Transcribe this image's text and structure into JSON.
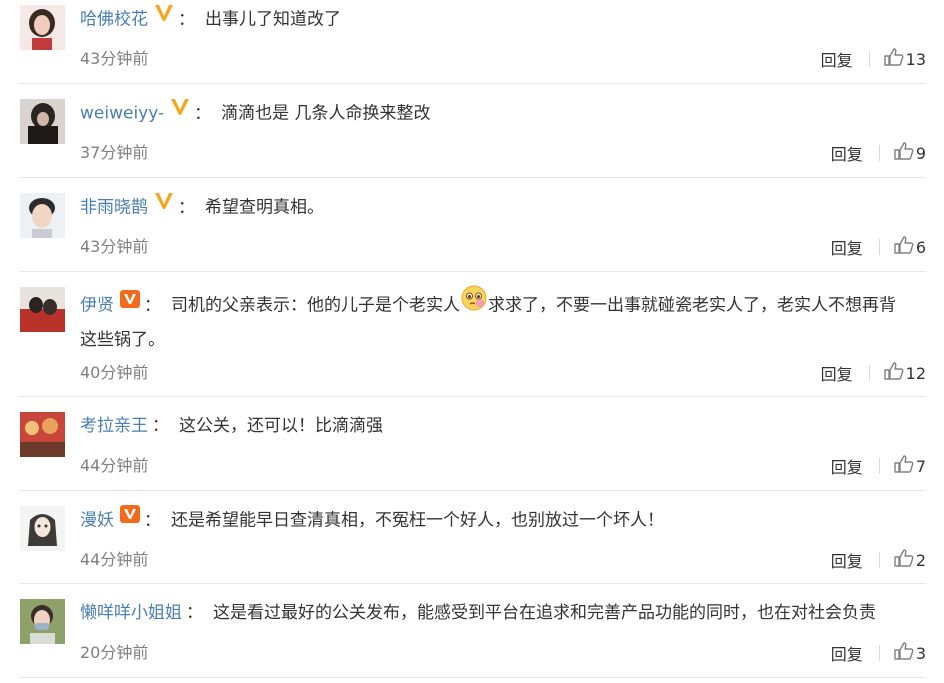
{
  "comments": [
    {
      "user": "哈佛校花",
      "badge": "yellow-v-icon",
      "text": "出事儿了知道改了",
      "time": "43分钟前",
      "reply": "回复",
      "likes": "13"
    },
    {
      "user": "weiweiyy-",
      "badge": "yellow-v-icon",
      "text": "滴滴也是 几条人命换来整改",
      "time": "37分钟前",
      "reply": "回复",
      "likes": "9"
    },
    {
      "user": "非雨晓鹊",
      "badge": "yellow-v-icon",
      "text": "希望查明真相。",
      "time": "43分钟前",
      "reply": "回复",
      "likes": "6"
    },
    {
      "user": "伊贤",
      "badge": "orange-v-icon",
      "text_a": "司机的父亲表示：他的儿子是个老实人",
      "text_b": "求求了，不要一出事就碰瓷老实人了，老实人不想再背",
      "text_c": "这些锅了。",
      "emoji": "pleading-face-emoji",
      "time": "40分钟前",
      "reply": "回复",
      "likes": "12"
    },
    {
      "user": "考拉亲王",
      "badge": "",
      "text": "这公关，还可以！比滴滴强",
      "time": "44分钟前",
      "reply": "回复",
      "likes": "7"
    },
    {
      "user": "漫妖",
      "badge": "orange-v-icon",
      "text": "还是希望能早日查清真相，不冤枉一个好人，也别放过一个坏人！",
      "time": "44分钟前",
      "reply": "回复",
      "likes": "2"
    },
    {
      "user": "懒咩咩小姐姐",
      "badge": "",
      "text": "这是看过最好的公关发布，能感受到平台在追求和完善产品功能的同时，也在对社会负责",
      "time": "20分钟前",
      "reply": "回复",
      "likes": "3"
    }
  ],
  "colon": "："
}
